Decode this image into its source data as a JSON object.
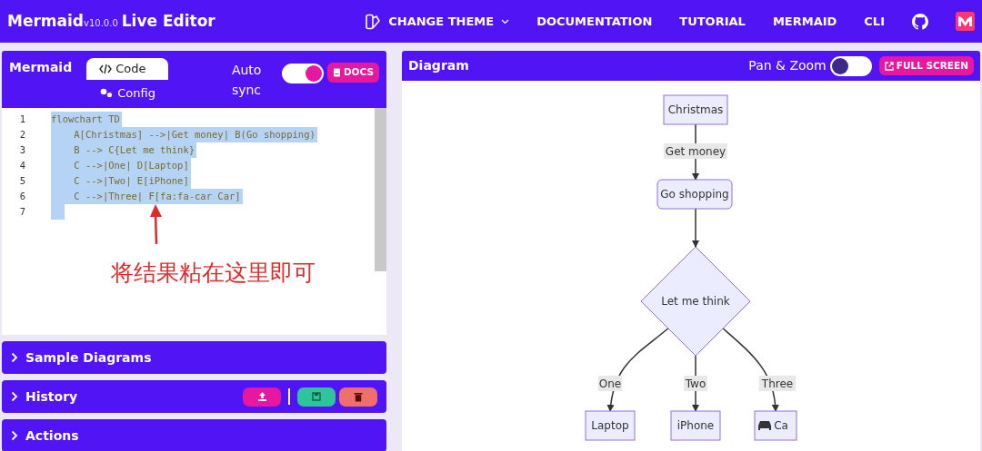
{
  "navbar": {
    "brand": "Mermaid",
    "version": "v10.0.0",
    "subtitle": "Live Editor",
    "theme_button": "CHANGE THEME",
    "links": [
      "DOCUMENTATION",
      "TUTORIAL",
      "MERMAID",
      "CLI"
    ]
  },
  "editor": {
    "title": "Mermaid",
    "tabs": [
      {
        "label": "Code",
        "selected": true
      },
      {
        "label": "Config",
        "selected": false
      }
    ],
    "auto_sync_label": "Auto sync",
    "auto_sync": true,
    "docs_button": "DOCS",
    "lines": [
      {
        "number": "1",
        "text": "flowchart TD",
        "selected": true
      },
      {
        "number": "2",
        "text": "    A[Christmas] -->|Get money| B(Go shopping)",
        "selected": true
      },
      {
        "number": "3",
        "text": "    B --> C{Let me think}",
        "selected": true
      },
      {
        "number": "4",
        "text": "    C -->|One| D[Laptop]",
        "selected": true
      },
      {
        "number": "5",
        "text": "    C -->|Two| E[iPhone]",
        "selected": true
      },
      {
        "number": "6",
        "text": "    C -->|Three| F[fa:fa-car Car]",
        "selected": true
      },
      {
        "number": "7",
        "selected": true
      }
    ],
    "annotation": "将结果粘在这里即可"
  },
  "sections": [
    {
      "title": "Sample Diagrams",
      "expanded": false
    },
    {
      "title": "History",
      "expanded": false,
      "actions": true
    },
    {
      "title": "Actions",
      "expanded": false
    }
  ],
  "diagram": {
    "title": "Diagram",
    "pan_zoom_label": "Pan & Zoom",
    "pan_zoom": false,
    "full_screen_button": "FULL SCREEN",
    "nodes": [
      {
        "kind": "box",
        "label": "Christmas"
      },
      {
        "kind": "round",
        "label": "Go shopping"
      },
      {
        "kind": "diamond",
        "label": "Let me think"
      },
      {
        "kind": "box",
        "label": "Laptop"
      },
      {
        "kind": "box",
        "label": "iPhone"
      },
      {
        "kind": "icon-box",
        "label": "Ca"
      }
    ],
    "edge_labels": [
      "Get money",
      "One",
      "Two",
      "Three"
    ]
  }
}
